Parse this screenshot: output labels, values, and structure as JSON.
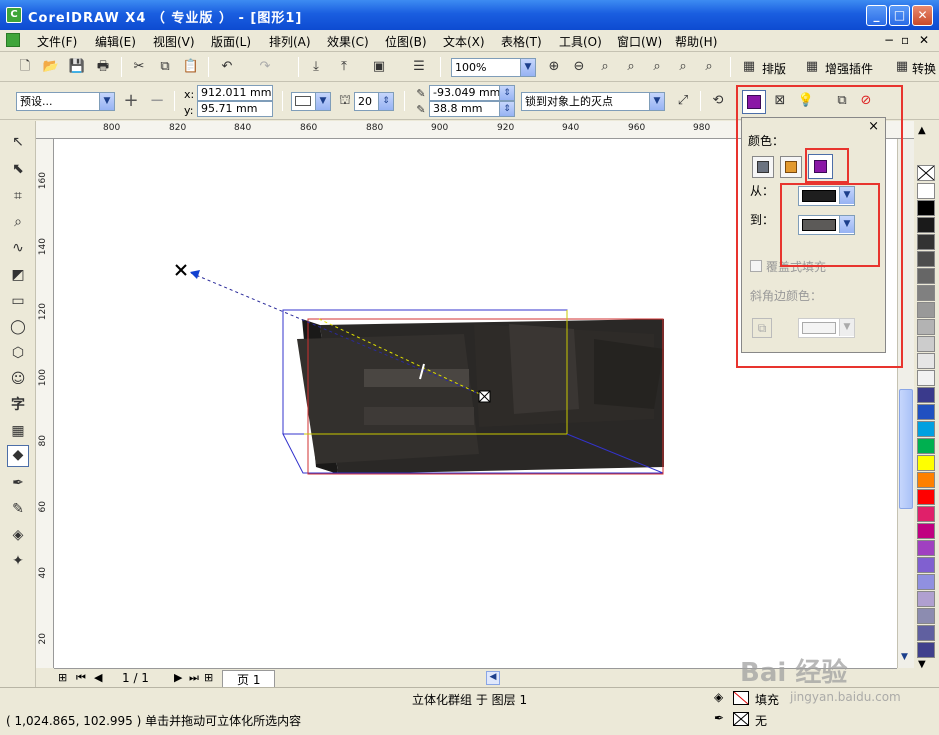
{
  "window": {
    "title": "CorelDRAW X4 （ 专业版 ） - [图形1]",
    "app_icon": "coreldraw-icon"
  },
  "menu": [
    "文件(F)",
    "编辑(E)",
    "视图(V)",
    "版面(L)",
    "排列(A)",
    "效果(C)",
    "位图(B)",
    "文本(X)",
    "表格(T)",
    "工具(O)",
    "窗口(W)",
    "帮助(H)"
  ],
  "toolbar": {
    "zoom": "100%",
    "btn_layout": "排版",
    "btn_plugins": "增强插件",
    "btn_convert": "转换"
  },
  "propbar": {
    "preset": "预设...",
    "x": "912.011 mm",
    "y": "95.71 mm",
    "depth": "20",
    "vp_x": "-93.049 mm",
    "vp_y": "38.8 mm",
    "vp_lock": "锁到对象上的灭点"
  },
  "hruler_labels": [
    "800",
    "820",
    "840",
    "860",
    "880",
    "900",
    "920",
    "940",
    "960",
    "980"
  ],
  "vruler_labels": [
    "160",
    "140",
    "120",
    "100",
    "80",
    "60",
    "40",
    "20"
  ],
  "docker": {
    "colors_label": "颜色：",
    "from_label": "从：",
    "to_label": "到：",
    "from_color": "#1e1e1e",
    "to_color": "#5c5a58",
    "overprint_label": "覆盖式填充",
    "bevel_label": "斜角边颜色：",
    "close": "×"
  },
  "pagebar": {
    "page_count": "1 / 1",
    "page_tab": "页 1"
  },
  "status": {
    "object_info": "立体化群组 于 图层 1",
    "coords_hint": "( 1,024.865, 102.995 ) 单击并拖动可立体化所选内容",
    "fill_label": "填充",
    "outline_label": "无"
  },
  "watermark": {
    "text": "Bai 经验",
    "url": "jingyan.baidu.com"
  },
  "palette": [
    "#ffffff",
    "#000000",
    "#1a1a1a",
    "#333333",
    "#4d4d4d",
    "#666666",
    "#808080",
    "#999999",
    "#b3b3b3",
    "#cccccc",
    "#e6e6e6",
    "#f2f2f2",
    "#3a3a8c",
    "#2050c0",
    "#00a0e0",
    "#00b050",
    "#ffff00",
    "#ff8000",
    "#ff0000",
    "#e0206a",
    "#c00080",
    "#a040c0",
    "#8060d0",
    "#9090e0",
    "#b0a0d0",
    "#8c8cb0",
    "#6060a0",
    "#40408c"
  ]
}
